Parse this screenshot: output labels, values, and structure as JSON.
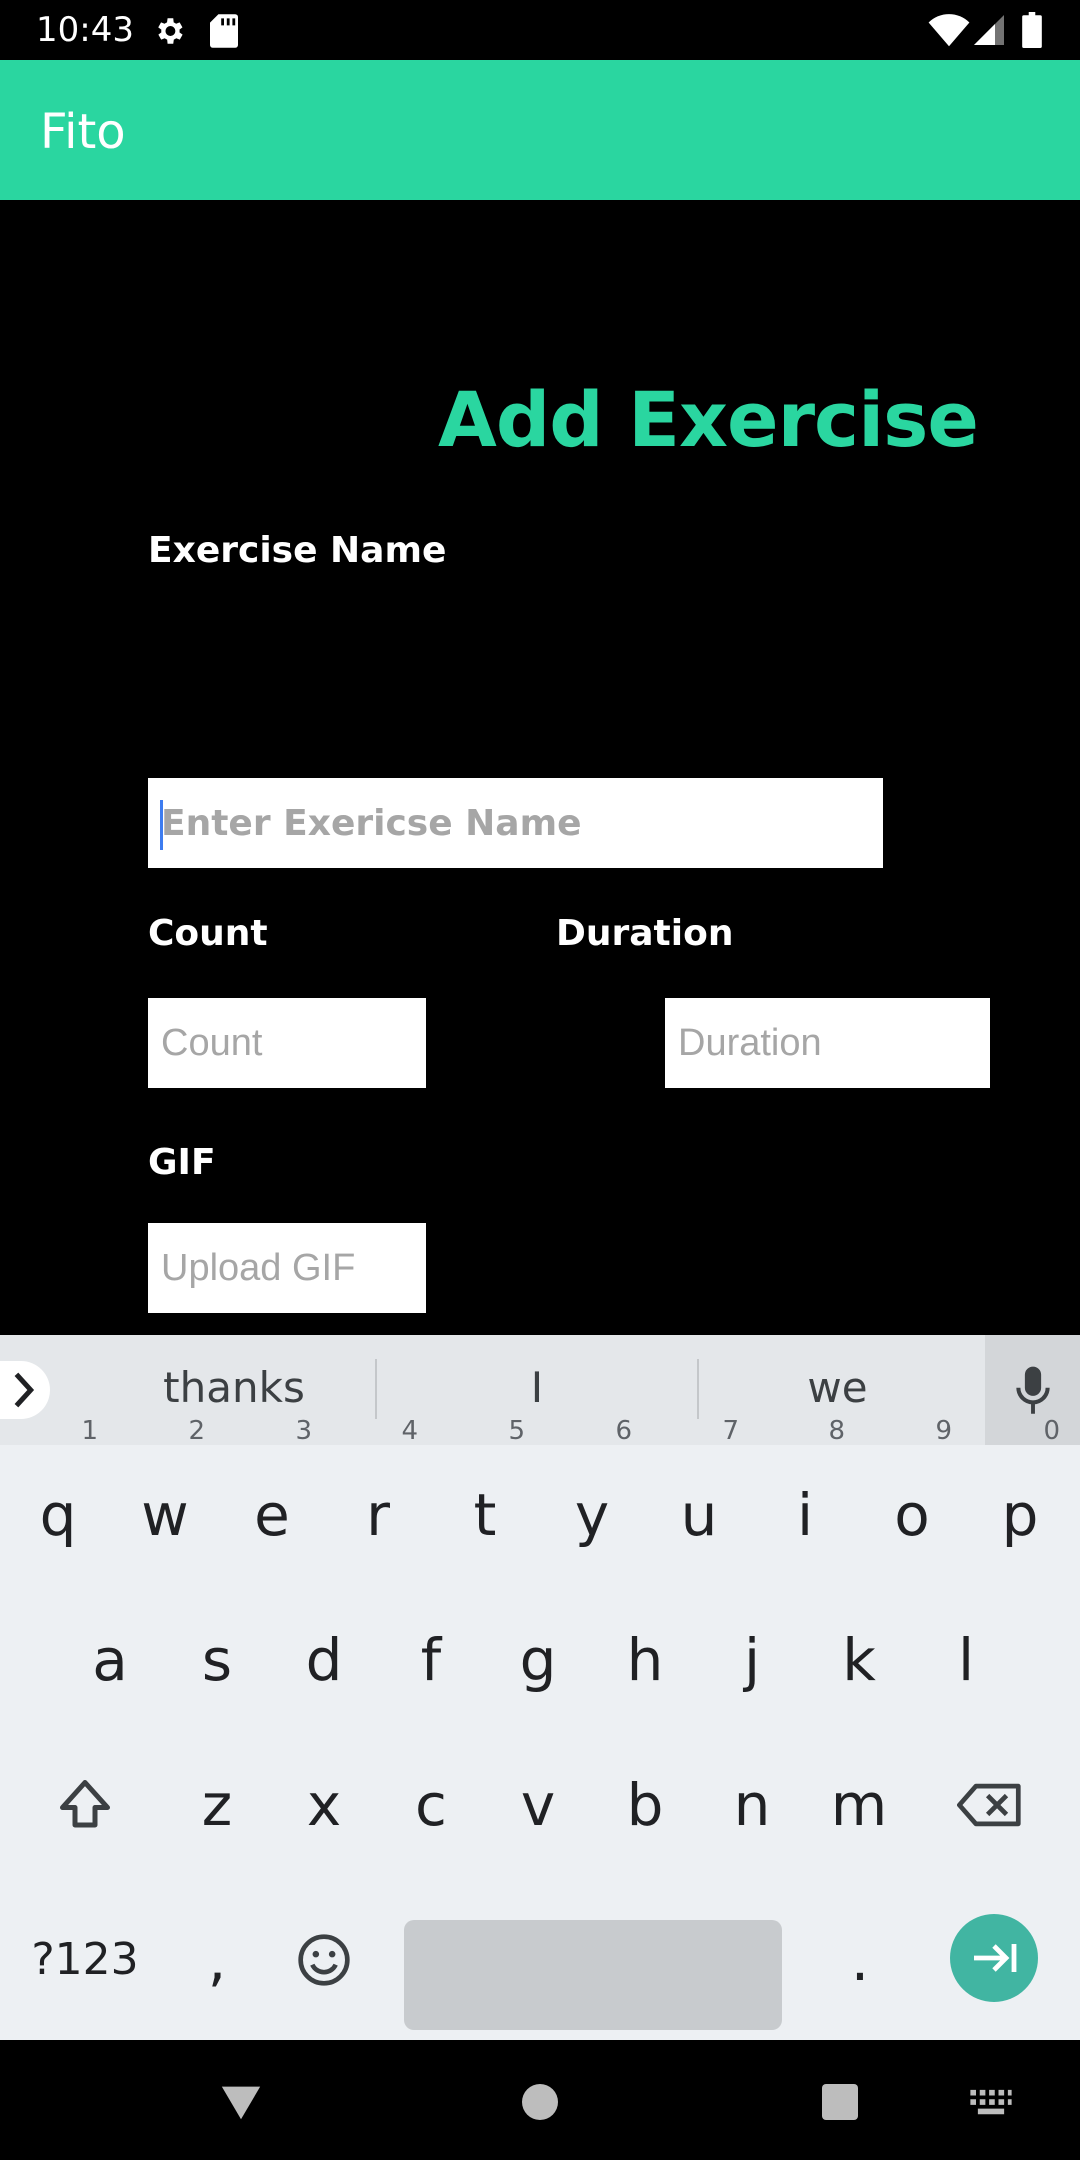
{
  "status_bar": {
    "time": "10:43",
    "icons": [
      "settings-icon",
      "sd-card-icon",
      "wifi-icon",
      "signal-icon",
      "battery-icon"
    ]
  },
  "app_bar": {
    "title": "Fito"
  },
  "form": {
    "heading": "Add Exercise",
    "exercise_name": {
      "label": "Exercise Name",
      "placeholder": "Enter Exericse Name",
      "value": ""
    },
    "count": {
      "label": "Count",
      "placeholder": "Count",
      "value": ""
    },
    "duration": {
      "label": "Duration",
      "placeholder": "Duration",
      "value": ""
    },
    "gif": {
      "label": "GIF",
      "placeholder": "Upload GIF",
      "value": ""
    }
  },
  "keyboard": {
    "suggestions": [
      "thanks",
      "I",
      "we"
    ],
    "row1": [
      {
        "k": "q",
        "n": "1"
      },
      {
        "k": "w",
        "n": "2"
      },
      {
        "k": "e",
        "n": "3"
      },
      {
        "k": "r",
        "n": "4"
      },
      {
        "k": "t",
        "n": "5"
      },
      {
        "k": "y",
        "n": "6"
      },
      {
        "k": "u",
        "n": "7"
      },
      {
        "k": "i",
        "n": "8"
      },
      {
        "k": "o",
        "n": "9"
      },
      {
        "k": "p",
        "n": "0"
      }
    ],
    "row2": [
      "a",
      "s",
      "d",
      "f",
      "g",
      "h",
      "j",
      "k",
      "l"
    ],
    "row3": [
      "z",
      "x",
      "c",
      "v",
      "b",
      "n",
      "m"
    ],
    "symbols_label": "?123",
    "comma_label": ",",
    "period_label": ".",
    "accent_color": "#41b5a2"
  },
  "colors": {
    "brand": "#2ad6a0",
    "background": "#000000"
  }
}
